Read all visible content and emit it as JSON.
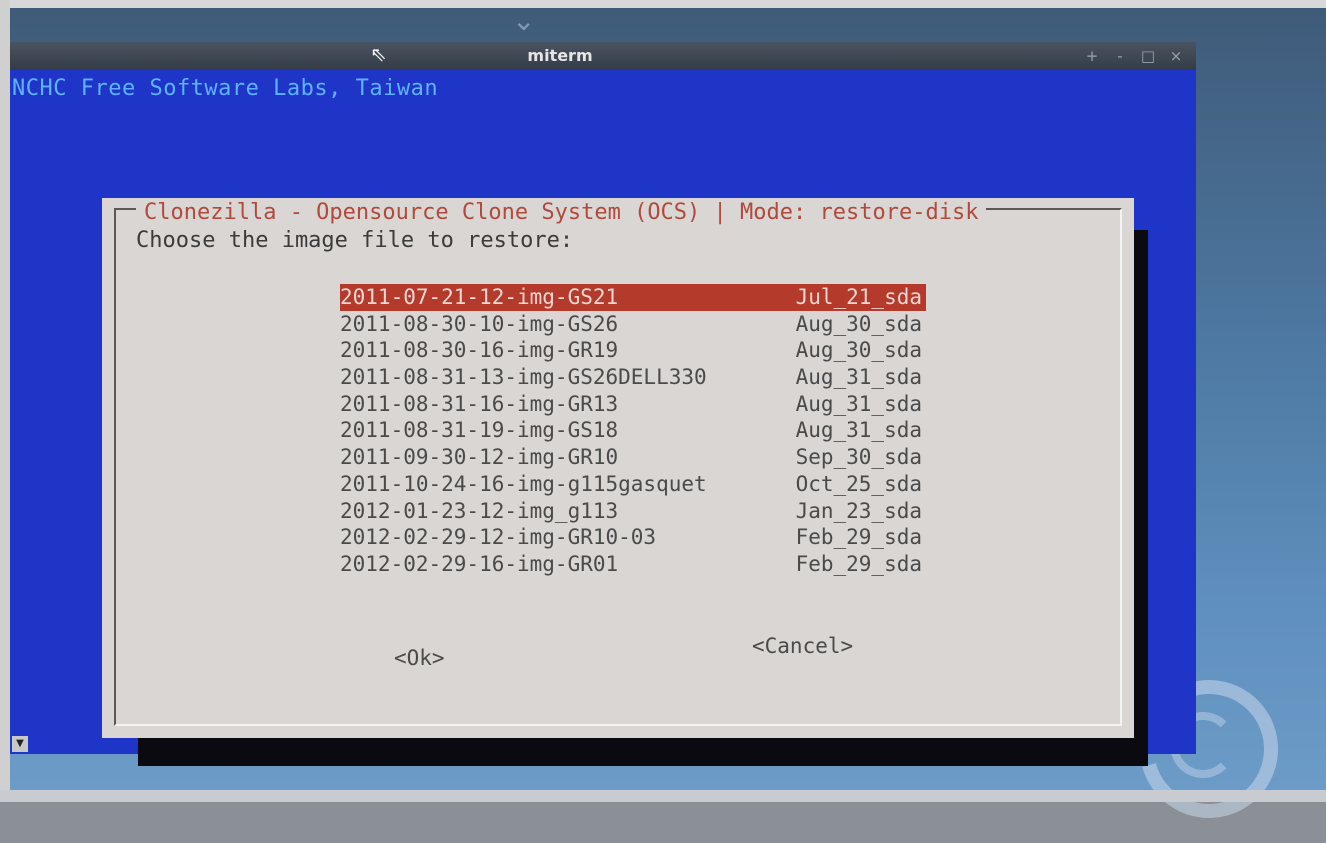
{
  "window": {
    "title": "miterm",
    "controls": [
      "+",
      "-",
      "□",
      "×"
    ]
  },
  "terminal": {
    "header": "NCHC Free Software Labs, Taiwan"
  },
  "dialog": {
    "title": "Clonezilla - Opensource Clone System (OCS) | Mode: restore-disk",
    "prompt": "Choose the image file to restore:",
    "images": [
      {
        "name": "2011-07-21-12-img-GS21",
        "date": "Jul_21_sda",
        "selected": true
      },
      {
        "name": "2011-08-30-10-img-GS26",
        "date": "Aug_30_sda",
        "selected": false
      },
      {
        "name": "2011-08-30-16-img-GR19",
        "date": "Aug_30_sda",
        "selected": false
      },
      {
        "name": "2011-08-31-13-img-GS26DELL330",
        "date": "Aug_31_sda",
        "selected": false
      },
      {
        "name": "2011-08-31-16-img-GR13",
        "date": "Aug_31_sda",
        "selected": false
      },
      {
        "name": "2011-08-31-19-img-GS18",
        "date": "Aug_31_sda",
        "selected": false
      },
      {
        "name": "2011-09-30-12-img-GR10",
        "date": "Sep_30_sda",
        "selected": false
      },
      {
        "name": "2011-10-24-16-img-g115gasquet",
        "date": "Oct_25_sda",
        "selected": false
      },
      {
        "name": "2012-01-23-12-img_g113",
        "date": "Jan_23_sda",
        "selected": false
      },
      {
        "name": "2012-02-29-12-img-GR10-03",
        "date": "Feb_29_sda",
        "selected": false
      },
      {
        "name": "2012-02-29-16-img-GR01",
        "date": "Feb_29_sda",
        "selected": false
      }
    ],
    "ok_label": "<Ok>",
    "cancel_label": "<Cancel>"
  },
  "colors": {
    "terminal_bg": "#1f35c8",
    "dialog_bg": "#d9d6d3",
    "selection": "#b43a2c",
    "title_text": "#b04a3c"
  }
}
